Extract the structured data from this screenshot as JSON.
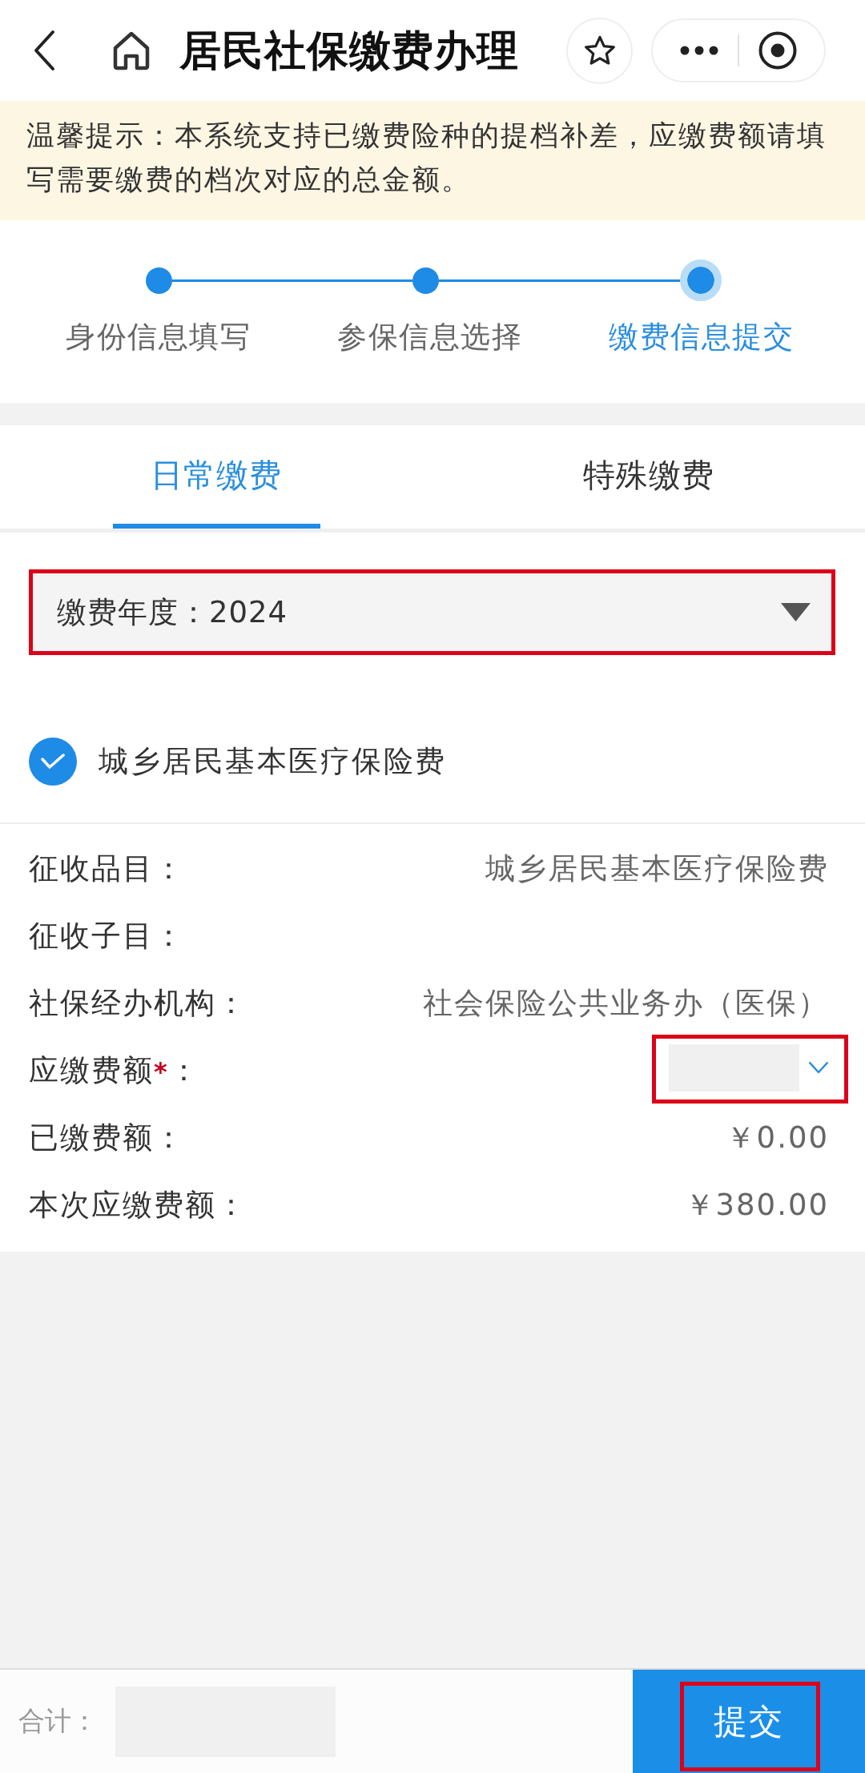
{
  "header": {
    "title": "居民社保缴费办理"
  },
  "notice": {
    "text": "温馨提示：本系统支持已缴费险种的提档补差，应缴费额请填写需要缴费的档次对应的总金额。"
  },
  "steps": [
    {
      "label": "身份信息填写",
      "current": false
    },
    {
      "label": "参保信息选择",
      "current": false
    },
    {
      "label": "缴费信息提交",
      "current": true
    }
  ],
  "tabs": [
    {
      "label": "日常缴费",
      "selected": true
    },
    {
      "label": "特殊缴费",
      "selected": false
    }
  ],
  "year_select": {
    "label": "缴费年度：",
    "value": "2024",
    "highlighted": true
  },
  "insurance_item": {
    "label": "城乡居民基本医疗保险费",
    "checked": true
  },
  "details": [
    {
      "kind": "text",
      "label": "征收品目：",
      "value": "城乡居民基本医疗保险费"
    },
    {
      "kind": "text",
      "label": "征收子目："
    },
    {
      "kind": "text",
      "label": "社保经办机构：",
      "value": "社会保险公共业务办（医保）"
    },
    {
      "kind": "select",
      "label": "应缴费额",
      "required_mark": "*",
      "label_end": "：",
      "highlighted": true
    },
    {
      "kind": "text",
      "label": "已缴费额：",
      "value": "￥0.00"
    },
    {
      "kind": "text",
      "label": "本次应缴费额：",
      "value": "￥380.00"
    }
  ],
  "footer": {
    "total_label": "合计：",
    "submit": {
      "label": "提交",
      "highlighted": true
    }
  }
}
